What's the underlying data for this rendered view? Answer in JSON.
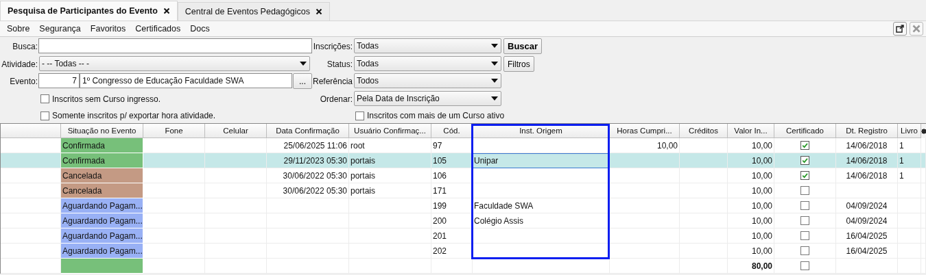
{
  "tabs": [
    {
      "label": "Pesquisa de Participantes do Evento",
      "selected": true
    },
    {
      "label": "Central de Eventos Pedagógicos",
      "selected": false
    }
  ],
  "menu": [
    "Sobre",
    "Segurança",
    "Favoritos",
    "Certificados",
    "Docs"
  ],
  "form": {
    "search": {
      "label": "Busca:"
    },
    "activity": {
      "label": "Atividade:",
      "value": "- -- Todas -- -"
    },
    "event": {
      "label": "Evento:",
      "code": "7",
      "name": "1º Congresso de Educação Faculdade SWA",
      "button": "..."
    },
    "inscricoes": {
      "label": "Inscrições:",
      "value": "Todas"
    },
    "status": {
      "label": "Status:",
      "value": "Todas"
    },
    "referencia": {
      "label": "Referência",
      "value": "Todos"
    },
    "ordenar": {
      "label": "Ordenar:",
      "value": "Pela Data de Inscrição"
    },
    "search_button": "Buscar",
    "filter_button": "Filtros",
    "checkboxes": [
      {
        "label": "Inscritos sem Curso ingresso.",
        "checked": false
      },
      {
        "label": "Somente inscritos p/ exportar hora atividade.",
        "checked": false
      },
      {
        "label": "Inscritos com mais de um Curso ativo",
        "checked": false
      }
    ]
  },
  "table": {
    "columns": [
      {
        "label": "Situação no Evento",
        "highlighted": false
      },
      {
        "label": "Fone",
        "highlighted": false
      },
      {
        "label": "Celular",
        "highlighted": false
      },
      {
        "label": "Data Confirmação",
        "highlighted": false
      },
      {
        "label": "Usuário Confirmaç...",
        "highlighted": false
      },
      {
        "label": "Cód.",
        "highlighted": false
      },
      {
        "label": "Inst. Origem",
        "highlighted": true
      },
      {
        "label": "Horas Cumpri...",
        "highlighted": false
      },
      {
        "label": "Créditos",
        "highlighted": false
      },
      {
        "label": "Valor In...",
        "highlighted": false
      },
      {
        "label": "Certificado",
        "highlighted": false
      },
      {
        "label": "Dt. Registro",
        "highlighted": false
      },
      {
        "label": "Livro",
        "highlighted": false
      }
    ],
    "rows": [
      {
        "kind": "entry",
        "selected": false,
        "status": {
          "text": "Confirmada",
          "color": "#77c07a"
        },
        "data": "25/06/2025 11:06",
        "usuario": "root",
        "cod": "97",
        "horas": "10,00",
        "valor": "10,00",
        "certificado": true,
        "registro": "14/06/2018",
        "livro": "1"
      },
      {
        "kind": "entry",
        "selected": true,
        "status": {
          "text": "Confirmada",
          "color": "#77c07a"
        },
        "data": "29/11/2023 05:30",
        "usuario": "portais",
        "cod": "105",
        "inst": "Unipar",
        "valor": "10,00",
        "certificado": true,
        "registro": "14/06/2018",
        "livro": "1"
      },
      {
        "kind": "entry",
        "selected": false,
        "status": {
          "text": "Cancelada",
          "color": "#c49a84"
        },
        "data": "30/06/2022 05:30",
        "usuario": "portais",
        "cod": "106",
        "valor": "10,00",
        "certificado": true,
        "registro": "14/06/2018",
        "livro": "1"
      },
      {
        "kind": "entry",
        "selected": false,
        "status": {
          "text": "Cancelada",
          "color": "#c49a84"
        },
        "data": "30/06/2022 05:30",
        "usuario": "portais",
        "cod": "171",
        "valor": "10,00",
        "certificado": false
      },
      {
        "kind": "entry",
        "selected": false,
        "status": {
          "text": "Aguardando Pagam...",
          "color": "#99b1f5"
        },
        "cod": "199",
        "inst": "Faculdade SWA",
        "valor": "10,00",
        "certificado": false,
        "registro": "04/09/2024"
      },
      {
        "kind": "entry",
        "selected": false,
        "status": {
          "text": "Aguardando Pagam...",
          "color": "#99b1f5"
        },
        "cod": "200",
        "inst": "Colégio Assis",
        "valor": "10,00",
        "certificado": false,
        "registro": "04/09/2024"
      },
      {
        "kind": "entry",
        "selected": false,
        "status": {
          "text": "Aguardando Pagam...",
          "color": "#99b1f5"
        },
        "cod": "201",
        "valor": "10,00",
        "certificado": false,
        "registro": "16/04/2025"
      },
      {
        "kind": "entry",
        "selected": false,
        "status": {
          "text": "Aguardando Pagam...",
          "color": "#99b1f5"
        },
        "cod": "202",
        "valor": "10,00",
        "certificado": false,
        "registro": "16/04/2025"
      },
      {
        "kind": "total",
        "selected": false,
        "status": {
          "color": "#77c07a"
        },
        "valor": "80,00",
        "certificado": false
      }
    ]
  }
}
